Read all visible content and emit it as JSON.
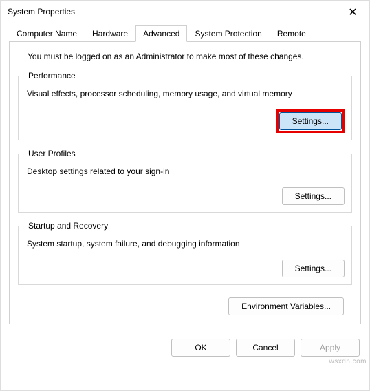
{
  "window": {
    "title": "System Properties",
    "close_symbol": "✕"
  },
  "tabs": [
    {
      "label": "Computer Name"
    },
    {
      "label": "Hardware"
    },
    {
      "label": "Advanced",
      "active": true
    },
    {
      "label": "System Protection"
    },
    {
      "label": "Remote"
    }
  ],
  "content": {
    "admin_note": "You must be logged on as an Administrator to make most of these changes.",
    "performance": {
      "legend": "Performance",
      "desc": "Visual effects, processor scheduling, memory usage, and virtual memory",
      "button": "Settings..."
    },
    "user_profiles": {
      "legend": "User Profiles",
      "desc": "Desktop settings related to your sign-in",
      "button": "Settings..."
    },
    "startup_recovery": {
      "legend": "Startup and Recovery",
      "desc": "System startup, system failure, and debugging information",
      "button": "Settings..."
    },
    "env_button": "Environment Variables..."
  },
  "footer": {
    "ok": "OK",
    "cancel": "Cancel",
    "apply": "Apply"
  },
  "watermark": "wsxdn.com"
}
